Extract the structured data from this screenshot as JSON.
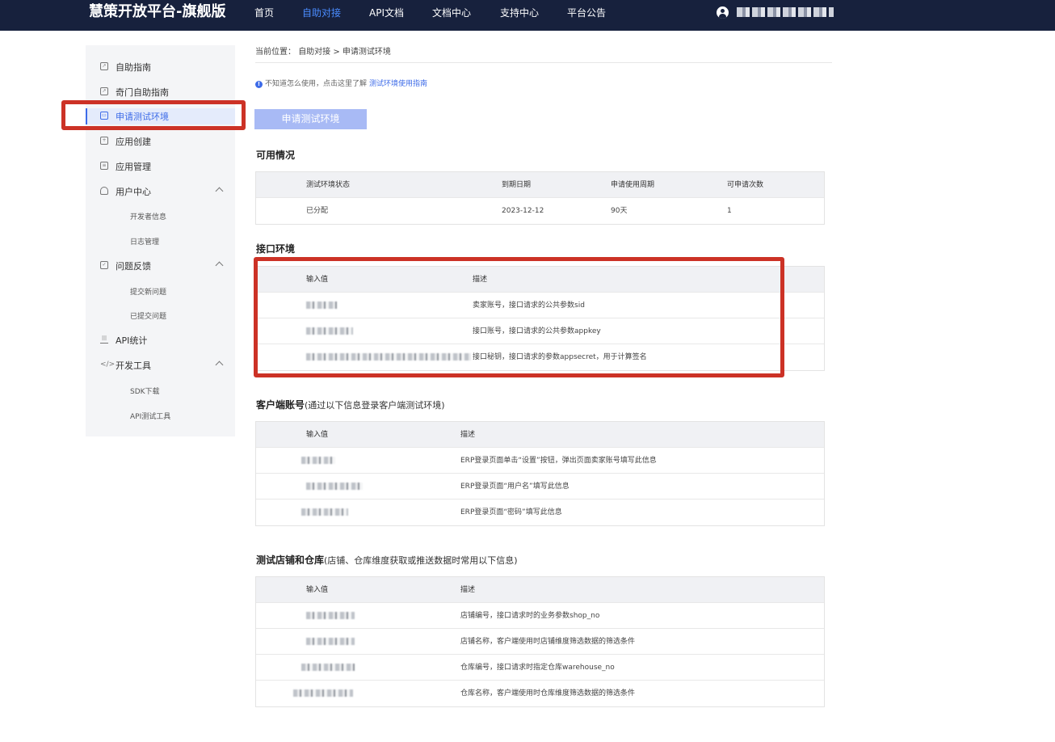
{
  "header": {
    "brand": "慧策开放平台-旗舰版",
    "nav": [
      "首页",
      "自助对接",
      "API文档",
      "文档中心",
      "支持中心",
      "平台公告"
    ],
    "active_nav": "自助对接",
    "user_icon": "user-avatar-icon"
  },
  "sidebar": {
    "items": [
      {
        "label": "自助指南",
        "icon": "guide-icon"
      },
      {
        "label": "奇门自助指南",
        "icon": "guide-icon"
      },
      {
        "label": "申请测试环境",
        "icon": "monitor-icon",
        "active": true
      },
      {
        "label": "应用创建",
        "icon": "app-create-icon"
      },
      {
        "label": "应用管理",
        "icon": "app-manage-icon"
      },
      {
        "label": "用户中心",
        "icon": "user-icon",
        "expanded": true
      },
      {
        "label": "开发者信息",
        "sub": true
      },
      {
        "label": "日志管理",
        "sub": true
      },
      {
        "label": "问题反馈",
        "icon": "feedback-icon",
        "expanded": true
      },
      {
        "label": "提交新问题",
        "sub": true
      },
      {
        "label": "已提交问题",
        "sub": true
      },
      {
        "label": "API统计",
        "icon": "chart-icon"
      },
      {
        "label": "开发工具",
        "icon": "code-icon",
        "expanded": true
      },
      {
        "label": "SDK下载",
        "sub": true
      },
      {
        "label": "API测试工具",
        "sub": true
      }
    ]
  },
  "breadcrumb": {
    "prefix": "当前位置：",
    "path": "自助对接 > 申请测试环境"
  },
  "hint": {
    "text": "不知道怎么使用，点击这里了解",
    "link": "测试环境使用指南"
  },
  "apply_button": "申请测试环境",
  "availability": {
    "title": "可用情况",
    "headers": [
      "测试环境状态",
      "到期日期",
      "申请使用周期",
      "可申请次数"
    ],
    "row": [
      "已分配",
      "2023-12-12",
      "90天",
      "1"
    ]
  },
  "interface_env": {
    "title": "接口环境",
    "headers": [
      "输入值",
      "描述"
    ],
    "rows": [
      "卖家账号，接口请求的公共参数sid",
      "接口账号，接口请求的公共参数appkey",
      "接口秘钥，接口请求的参数appsecret，用于计算签名"
    ]
  },
  "client_account": {
    "title": "客户端账号",
    "subtitle": "(通过以下信息登录客户端测试环境)",
    "headers": [
      "输入值",
      "描述"
    ],
    "rows": [
      "ERP登录页面单击“设置”按钮，弹出页面卖家账号填写此信息",
      "ERP登录页面“用户名”填写此信息",
      "ERP登录页面“密码”填写此信息"
    ]
  },
  "shop_warehouse": {
    "title": "测试店铺和仓库",
    "subtitle": "(店铺、仓库维度获取或推送数据时常用以下信息)",
    "headers": [
      "输入值",
      "描述"
    ],
    "rows": [
      "店铺编号，接口请求时的业务参数shop_no",
      "店铺名称，客户端使用时店铺维度筛选数据的筛选条件",
      "仓库编号，接口请求时指定仓库warehouse_no",
      "仓库名称，客户端使用时仓库维度筛选数据的筛选条件"
    ]
  },
  "colors": {
    "topbar": "#17213d",
    "accent": "#3d6be8",
    "annotation_red": "#cc3226",
    "button_disabled": "#a8baf5"
  }
}
